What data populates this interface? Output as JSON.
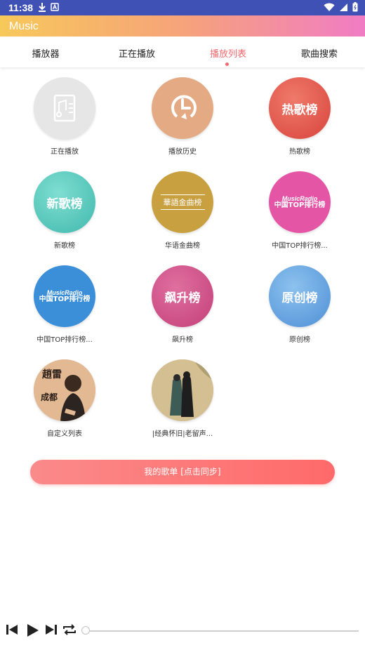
{
  "status_bar": {
    "time": "11:38"
  },
  "app": {
    "title": "Music"
  },
  "tabs": [
    {
      "label": "播放器"
    },
    {
      "label": "正在播放"
    },
    {
      "label": "播放列表"
    },
    {
      "label": "歌曲搜索"
    }
  ],
  "grid": {
    "items": [
      {
        "label": "正在播放",
        "circle_text": "",
        "icon": "music-doc-icon",
        "color": "#e6e6e6"
      },
      {
        "label": "播放历史",
        "circle_text": "",
        "icon": "history-clock-icon",
        "color": "#e4aa84"
      },
      {
        "label": "热歌榜",
        "circle_text": "热歌榜",
        "color": "#e05548"
      },
      {
        "label": "新歌榜",
        "circle_text": "新歌榜",
        "color": "#5cc9bd"
      },
      {
        "label": "华语金曲榜",
        "circle_text": "華語金曲榜",
        "color": "#c9a040"
      },
      {
        "label": "中国TOP排行榜...",
        "circle_text_top": "MusicRadio",
        "circle_text_bottom": "中国TOP排行榜",
        "color": "#e455a6"
      },
      {
        "label": "中国TOP排行榜...",
        "circle_text_top": "MusicRadio",
        "circle_text_bottom": "中国TOP排行榜",
        "color": "#3a8fd8"
      },
      {
        "label": "飙升榜",
        "circle_text": "飙升榜",
        "color": "#cf4f86"
      },
      {
        "label": "原创榜",
        "circle_text": "原创榜",
        "color": "#6aa7e0"
      },
      {
        "label": "自定义列表",
        "circle_text": "",
        "icon": "custom-cover-image",
        "color": "#d9a47b"
      },
      {
        "label": "|经典怀旧|老留声...",
        "circle_text": "",
        "icon": "classic-cover-image",
        "color": "#cdb888"
      }
    ]
  },
  "sync_button": {
    "label": "我的歌单 [点击同步]"
  },
  "player": {
    "progress": 0
  }
}
